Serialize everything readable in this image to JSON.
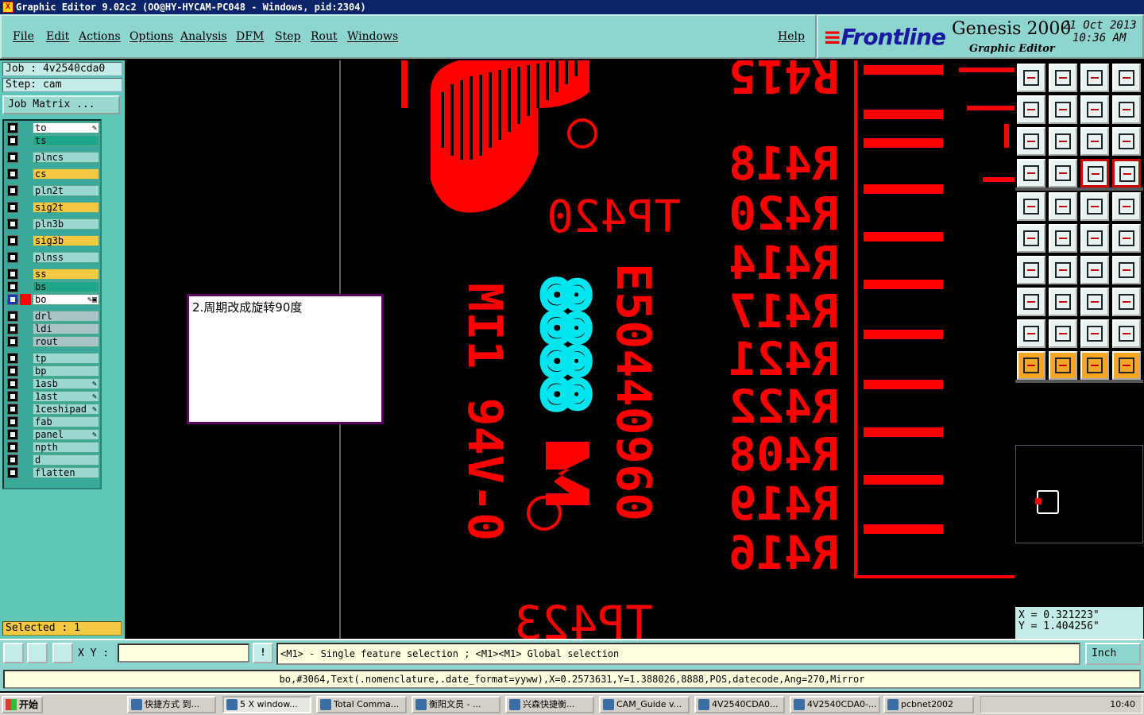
{
  "window": {
    "title": "Graphic Editor 9.02c2  (OO@HY-HYCAM-PC048 - Windows, pid:2304)"
  },
  "menu": {
    "items": [
      "File",
      "Edit",
      "Actions",
      "Options",
      "Analysis",
      "DFM",
      "Step",
      "Rout",
      "Windows"
    ],
    "help": "Help"
  },
  "branding": {
    "logo": "Frontline",
    "product": "Genesis 2000",
    "subtitle": "Graphic Editor",
    "date": "21 Oct 2013",
    "time": "10:36 AM"
  },
  "left_panel": {
    "job": "Job : 4v2540cda0",
    "step": "Step: cam",
    "job_matrix": "Job Matrix ...",
    "selected": "Selected : 1",
    "layers": [
      {
        "name": "to",
        "color": "#ffffff",
        "mark": "✎"
      },
      {
        "name": "ts",
        "color": "#1fa68a",
        "mark": ""
      },
      {
        "name": "plncs",
        "color": "#9ad8d0",
        "mark": ""
      },
      {
        "name": "cs",
        "color": "#f5c842",
        "mark": ""
      },
      {
        "name": "pln2t",
        "color": "#9ad8d0",
        "mark": ""
      },
      {
        "name": "sig2t",
        "color": "#f5c842",
        "mark": ""
      },
      {
        "name": "pln3b",
        "color": "#9ad8d0",
        "mark": ""
      },
      {
        "name": "sig3b",
        "color": "#f5c842",
        "mark": ""
      },
      {
        "name": "plnss",
        "color": "#9ad8d0",
        "mark": ""
      },
      {
        "name": "ss",
        "color": "#f5c842",
        "mark": ""
      },
      {
        "name": "bs",
        "color": "#1fa68a",
        "mark": ""
      },
      {
        "name": "bo",
        "color": "#ffffff",
        "mark": "✎▣"
      },
      {
        "name": "drl",
        "color": "#a8c4c4",
        "mark": ""
      },
      {
        "name": "ldi",
        "color": "#a8c4c4",
        "mark": ""
      },
      {
        "name": "rout",
        "color": "#a8c4c4",
        "mark": ""
      },
      {
        "name": "tp",
        "color": "#9ad8d0",
        "mark": ""
      },
      {
        "name": "bp",
        "color": "#9ad8d0",
        "mark": ""
      },
      {
        "name": "1asb",
        "color": "#9ad8d0",
        "mark": "✎"
      },
      {
        "name": "1ast",
        "color": "#9ad8d0",
        "mark": "✎"
      },
      {
        "name": "1ceshipad",
        "color": "#9ad8d0",
        "mark": "✎"
      },
      {
        "name": "fab",
        "color": "#9ad8d0",
        "mark": ""
      },
      {
        "name": "panel",
        "color": "#9ad8d0",
        "mark": "✎"
      },
      {
        "name": "npth",
        "color": "#9ad8d0",
        "mark": ""
      },
      {
        "name": "d",
        "color": "#9ad8d0",
        "mark": ""
      },
      {
        "name": "flatten",
        "color": "#9ad8d0",
        "mark": ""
      }
    ]
  },
  "canvas": {
    "note": "2.周期改成旋转90度",
    "labels_right": [
      "R415",
      "R418",
      "R420",
      "R414",
      "R417",
      "R421",
      "R422",
      "R408",
      "R419",
      "R416"
    ],
    "label_tp420": "TP420",
    "label_tp423": "TP423",
    "vertical_1": "E50440960",
    "vertical_2": "MI1 94V-0",
    "digits": "8888",
    "registered": "®"
  },
  "coords": {
    "x": "X = 0.321223\"",
    "y": "Y = 1.404256\""
  },
  "status": {
    "xy_label": "X Y :",
    "xy_value": "",
    "hint": "<M1> - Single feature selection ; <M1><M1> Global selection",
    "units": "Inch"
  },
  "feature_info": "bo,#3064,Text(.nomenclature,.date_format=yyww),X=0.2573631,Y=1.388026,8888,POS,datecode,Ang=270,Mirror",
  "taskbar": {
    "start": "开始",
    "tasks": [
      "快捷方式 到...",
      "5 X window...",
      "Total Comma...",
      "衡阳文员 - ...",
      "兴森快捷衡...",
      "CAM_Guide v...",
      "4V2540CDA0...",
      "4V2540CDA0-...",
      "pcbnet2002"
    ],
    "clock": "10:40"
  },
  "colors": {
    "silkscreen": "#ff0000",
    "datecode": "#00e5ee",
    "accent": "#8ed4cf"
  }
}
